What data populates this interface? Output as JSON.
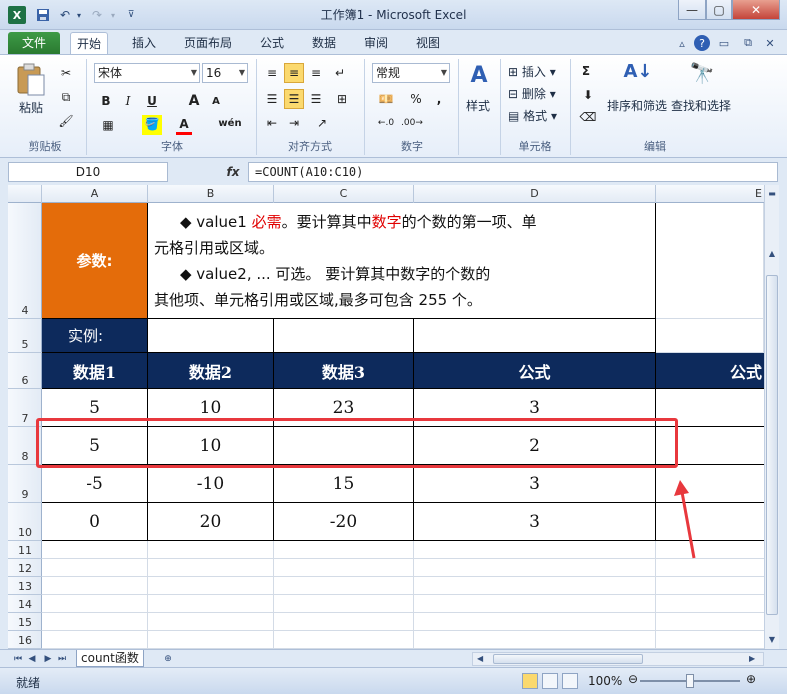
{
  "window": {
    "title": "工作簿1 - Microsoft Excel"
  },
  "ribbon_tabs": [
    "文件",
    "开始",
    "插入",
    "页面布局",
    "公式",
    "数据",
    "审阅",
    "视图"
  ],
  "ribbon": {
    "clipboard": {
      "paste": "粘贴",
      "group": "剪贴板"
    },
    "font": {
      "name": "宋体",
      "size": "16",
      "bold": "B",
      "italic": "I",
      "underline": "U",
      "grow": "A",
      "shrink": "A",
      "color": "A",
      "wen": "wén",
      "group": "字体"
    },
    "alignment": {
      "group": "对齐方式"
    },
    "number": {
      "format": "常规",
      "percent": "%",
      "comma": ",",
      "group": "数字"
    },
    "styles": {
      "label": "样式"
    },
    "cells": {
      "insert": "插入",
      "delete": "删除",
      "format": "格式",
      "group": "单元格"
    },
    "editing": {
      "sigma": "Σ",
      "sort": "排序和筛选",
      "find": "查找和选择",
      "group": "编辑"
    }
  },
  "formula_bar": {
    "name_box": "D10",
    "fx": "fx",
    "formula": "=COUNT(A10:C10)"
  },
  "columns": [
    "A",
    "B",
    "C",
    "D",
    "E"
  ],
  "rows": [
    "4",
    "5",
    "6",
    "7",
    "8",
    "9",
    "10",
    "11",
    "12",
    "13",
    "14",
    "15",
    "16"
  ],
  "content": {
    "param_label": "参数:",
    "desc_line1a": "◆ value1 ",
    "desc_required": "必需",
    "desc_line1b": "。要计算其中",
    "desc_number": "数字",
    "desc_line1c": "的个数的第一项、单",
    "desc_line2": "元格引用或区域。",
    "desc_line3": "◆ value2, ...    可选。 要计算其中数字的个数的",
    "desc_line4": "其他项、单元格引用或区域,最多可包含 255 个。",
    "example_label": "实例:",
    "headers": [
      "数据1",
      "数据2",
      "数据3",
      "公式",
      "公式"
    ],
    "data_rows": [
      [
        "5",
        "10",
        "23",
        "3"
      ],
      [
        "5",
        "10",
        "",
        "2"
      ],
      [
        "-5",
        "-10",
        "15",
        "3"
      ],
      [
        "0",
        "20",
        "-20",
        "3"
      ]
    ]
  },
  "sheet_tab": "count函数",
  "status": {
    "ready": "就绪",
    "zoom": "100%"
  },
  "colors": {
    "param_bg": "#e46c0a",
    "header_bg": "#0d2a5c",
    "highlight": "#e8383d",
    "red_text": "#e00000"
  }
}
